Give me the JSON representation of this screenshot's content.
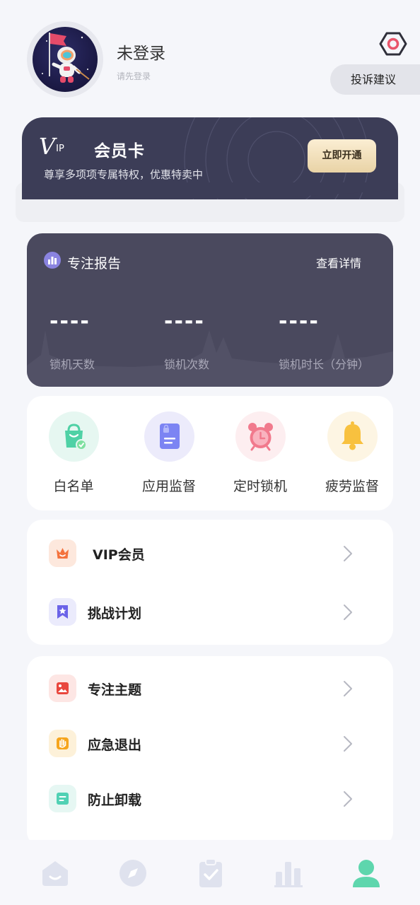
{
  "user": {
    "name": "未登录",
    "subtitle": "请先登录"
  },
  "header": {
    "complaint_label": "投诉建议"
  },
  "vip_card": {
    "logo_big": "V",
    "logo_small": "IP",
    "title": "会员卡",
    "description": "尊享多项项专属特权，优惠特卖中",
    "open_button": "立即开通"
  },
  "report": {
    "title": "专注报告",
    "detail_link": "查看详情",
    "stats": [
      {
        "value": "----",
        "label": "锁机天数"
      },
      {
        "value": "----",
        "label": "锁机次数"
      },
      {
        "value": "----",
        "label": "锁机时长（分钟）"
      }
    ]
  },
  "tools": [
    {
      "label": "白名单",
      "icon": "shopping-bag-icon",
      "bg": "#e6f7f1",
      "color": "#4fd1a5"
    },
    {
      "label": "应用监督",
      "icon": "document-lock-icon",
      "bg": "#ecebfb",
      "color": "#7c84f3"
    },
    {
      "label": "定时锁机",
      "icon": "alarm-clock-icon",
      "bg": "#fdeef0",
      "color": "#f17a8d"
    },
    {
      "label": "疲劳监督",
      "icon": "bell-icon",
      "bg": "#fdf5e3",
      "color": "#f8c13f"
    }
  ],
  "menu_group_1": [
    {
      "label": "VIP会员",
      "icon": "crown-icon",
      "bg": "#fde8dd",
      "color": "#f4733e"
    },
    {
      "label": "挑战计划",
      "icon": "bookmark-star-icon",
      "bg": "#ebebfc",
      "color": "#6b63e8"
    }
  ],
  "menu_group_2": [
    {
      "label": "专注主题",
      "icon": "image-icon",
      "bg": "#fde6e4",
      "color": "#e9463d"
    },
    {
      "label": "应急退出",
      "icon": "hand-icon",
      "bg": "#fdf1d9",
      "color": "#f6a51d"
    },
    {
      "label": "防止卸载",
      "icon": "document-icon",
      "bg": "#e6f7f3",
      "color": "#50d1b4"
    }
  ],
  "bottom_nav": [
    {
      "icon": "home-icon",
      "active": false
    },
    {
      "icon": "compass-icon",
      "active": false
    },
    {
      "icon": "clipboard-check-icon",
      "active": false
    },
    {
      "icon": "bar-chart-icon",
      "active": false
    },
    {
      "icon": "user-icon",
      "active": true
    }
  ],
  "colors": {
    "background": "#f5f6fa",
    "vip_card": "#3c3d57",
    "report_card": "#4a495e",
    "nav_inactive": "#dfe2ee",
    "nav_active": "#5ed6ad"
  }
}
